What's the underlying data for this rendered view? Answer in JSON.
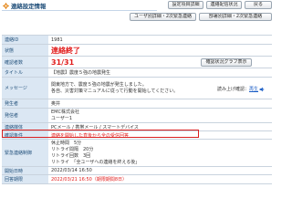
{
  "header": {
    "title": "連絡設定情報",
    "gear_icon": "gear-icon",
    "accent": "#1f4e79"
  },
  "buttons": {
    "settings_detail": "設定項目詳細",
    "contact_status": "連絡配信状況",
    "back": "戻る",
    "user_detail": "ユーザ別詳細・2次緊急連絡",
    "dept_detail": "部署別詳細・2次緊急連絡",
    "confirm_graph": "確認状況グラフ表示"
  },
  "fields": {
    "contact_id": {
      "label": "連絡ID",
      "value": "1981"
    },
    "status": {
      "label": "状態",
      "value": "連絡終了"
    },
    "confirm_count": {
      "label": "確認者数",
      "value": "31/31"
    },
    "title": {
      "label": "タイトル",
      "value": "【地震】震度５強の地震発生"
    },
    "message": {
      "label": "メッセージ",
      "lines": [
        "関東地方で、震度５強の地震が発生しました。",
        "各自、災害対策マニュアルに従って行動を開始してください。"
      ]
    },
    "voice_check": {
      "label": "読み上げ確認：",
      "link": "再生",
      "speaker_icon": "speaker-icon"
    },
    "sender": {
      "label": "発生者",
      "value": "奥井"
    },
    "recipients": {
      "label": "発信者",
      "lines": [
        "EMC株式会社",
        "ユーザー1"
      ]
    },
    "media": {
      "label": "連絡媒体",
      "value": "PCメール / 携帯メール / スマートデバイス"
    },
    "conditions": {
      "label": "確認条件",
      "value": "連絡を開始した直後から全の受信回答"
    },
    "emergency": {
      "label": "緊急連絡制御",
      "lines": [
        "休止時間　5分",
        "リトライ間隔　20分",
        "リトライ回数　3回",
        "リトライ　「全ユーザへの連絡を終える後」"
      ]
    },
    "start_time": {
      "label": "開始日時",
      "value": "2022/03/14 16:50"
    },
    "end_time": {
      "label": "回答期限",
      "value": "2022/03/21 16:50（期限期間8日）"
    }
  },
  "colors": {
    "label_bg": "#dbe7f3",
    "label_text": "#1f4e79",
    "alert_red": "#e11d1d",
    "highlight_border": "#d92020"
  }
}
